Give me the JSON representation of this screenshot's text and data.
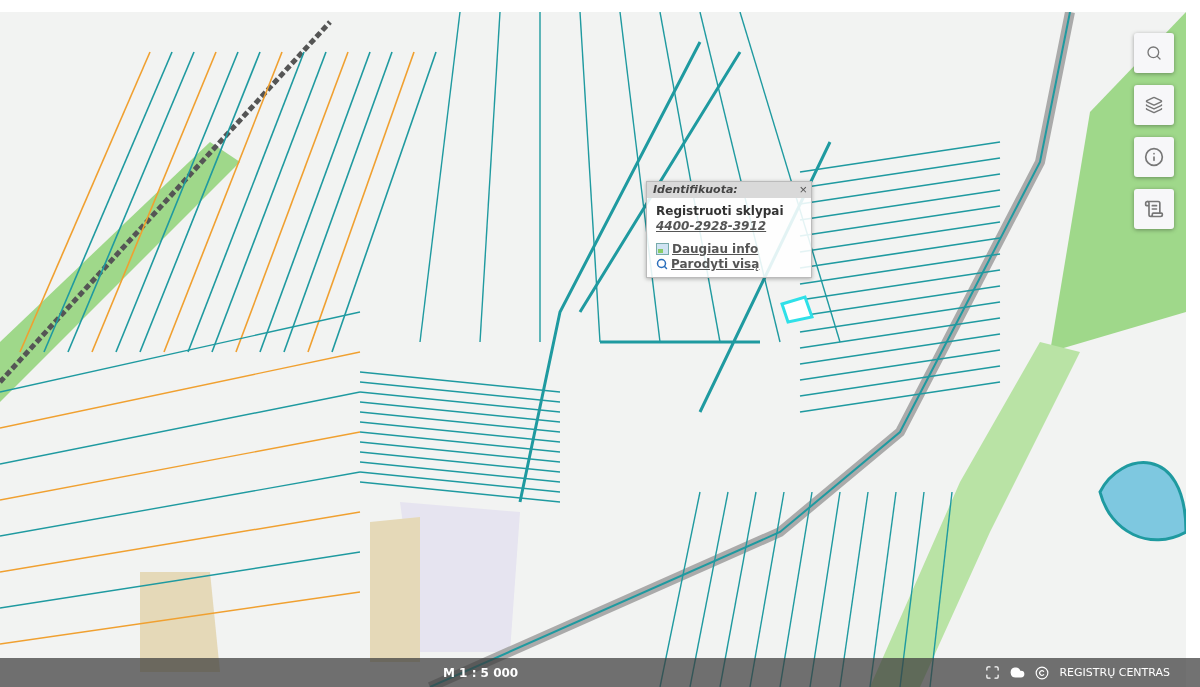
{
  "popup": {
    "title": "Identifikuota:",
    "close": "×",
    "layer": "Registruoti sklypai",
    "parcel_id": "4400-2928-3912",
    "links": [
      {
        "kind": "info",
        "label": "Daugiau info"
      },
      {
        "kind": "search",
        "label": "Parodyti visą"
      }
    ]
  },
  "tools": [
    {
      "kind": "search"
    },
    {
      "kind": "layers"
    },
    {
      "kind": "info"
    },
    {
      "kind": "legend"
    }
  ],
  "status_bar": {
    "scale": "M 1 : 5 000",
    "icons": [
      {
        "kind": "fullscreen"
      },
      {
        "kind": "cloud"
      },
      {
        "kind": "copyright"
      }
    ],
    "attribution": "REGISTRŲ CENTRAS"
  }
}
